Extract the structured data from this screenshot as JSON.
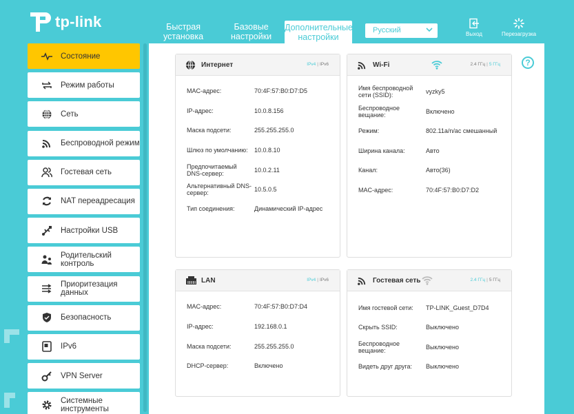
{
  "brand": {
    "name": "tp-link"
  },
  "header": {
    "tabs": [
      {
        "label_1": "Быстрая",
        "label_2": "установка"
      },
      {
        "label_1": "Базовые",
        "label_2": "настройки"
      },
      {
        "label_1": "Дополнительные",
        "label_2": "настройки"
      }
    ],
    "language": "Русский",
    "logout": "Выход",
    "reboot": "Перезагрузка"
  },
  "sidebar": {
    "items": [
      {
        "label": "Состояние",
        "icon": "pulse-icon"
      },
      {
        "label": "Режим работы",
        "icon": "swap-icon"
      },
      {
        "label": "Сеть",
        "icon": "globe-icon"
      },
      {
        "label": "Беспроводной режим",
        "icon": "wireless-icon"
      },
      {
        "label": "Гостевая сеть",
        "icon": "guest-icon"
      },
      {
        "label": "NAT переадресация",
        "icon": "nat-icon"
      },
      {
        "label": "Настройки USB",
        "icon": "usb-icon"
      },
      {
        "label": "Родительский контроль",
        "icon": "parental-icon"
      },
      {
        "label": "Приоритезация данных",
        "icon": "qos-icon"
      },
      {
        "label": "Безопасность",
        "icon": "shield-icon"
      },
      {
        "label": "IPv6",
        "icon": "ipv6-icon"
      },
      {
        "label": "VPN Server",
        "icon": "key-icon"
      },
      {
        "label": "Системные инструменты",
        "icon": "gear-icon"
      }
    ]
  },
  "internet": {
    "title": "Интернет",
    "tag_ipv4": "IPv4",
    "tag_ipv6": "IPv6",
    "rows": [
      {
        "k": "MAC-адрес:",
        "v": "70:4F:57:B0:D7:D5"
      },
      {
        "k": "IP-адрес:",
        "v": "10.0.8.156"
      },
      {
        "k": "Маска подсети:",
        "v": "255.255.255.0"
      },
      {
        "k": "Шлюз по умолчанию:",
        "v": "10.0.8.10"
      },
      {
        "k": "Предпочитаемый DNS-сервер:",
        "v": "10.0.2.11"
      },
      {
        "k": "Альтернативный DNS-сервер:",
        "v": "10.5.0.5"
      },
      {
        "k": "Тип соединения:",
        "v": "Динамический IP-адрес"
      }
    ]
  },
  "wifi": {
    "title": "Wi-Fi",
    "tag_24": "2.4 ГГц",
    "tag_5": "5 ГГц",
    "rows": [
      {
        "k": "Имя беспроводной сети (SSID):",
        "v": "vyzky5"
      },
      {
        "k": "Беспроводное вещание:",
        "v": "Включено"
      },
      {
        "k": "Режим:",
        "v": "802.11a/n/ac смешанный"
      },
      {
        "k": "Ширина канала:",
        "v": "Авто"
      },
      {
        "k": "Канал:",
        "v": "Авто(36)"
      },
      {
        "k": "MAC-адрес:",
        "v": "70:4F:57:B0:D7:D2"
      }
    ]
  },
  "lan": {
    "title": "LAN",
    "tag_ipv4": "IPv4",
    "tag_ipv6": "IPv6",
    "rows": [
      {
        "k": "MAC-адрес:",
        "v": "70:4F:57:B0:D7:D4"
      },
      {
        "k": "IP-адрес:",
        "v": "192.168.0.1"
      },
      {
        "k": "Маска подсети:",
        "v": "255.255.255.0"
      },
      {
        "k": "DHCP-сервер:",
        "v": "Включено"
      }
    ]
  },
  "guest": {
    "title": "Гостевая сеть",
    "tag_24": "2.4 ГГц",
    "tag_5": "5 ГГц",
    "rows": [
      {
        "k": "Имя гостевой сети:",
        "v": "TP-LINK_Guest_D7D4"
      },
      {
        "k": "Скрыть SSID:",
        "v": "Выключено"
      },
      {
        "k": "Беспроводное вещание:",
        "v": "Выключено"
      },
      {
        "k": "Видеть друг друга:",
        "v": "Выключено"
      }
    ]
  },
  "colors": {
    "accent": "#4acbd6",
    "active": "#ffc600"
  }
}
